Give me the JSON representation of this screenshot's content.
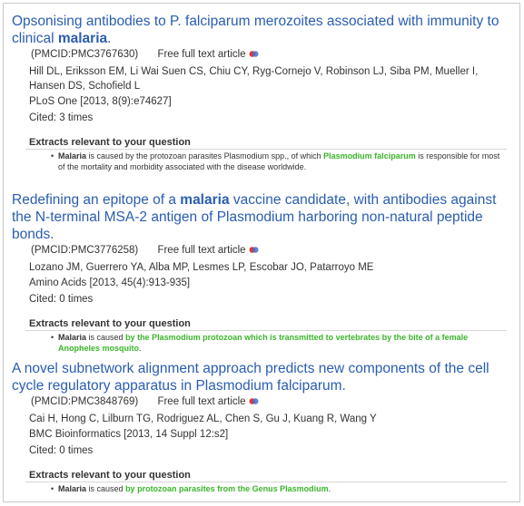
{
  "results": [
    {
      "title_pre": "Opsonising antibodies to P. falciparum merozoites associated with immunity to clinical ",
      "title_kw": "malaria",
      "title_post": ".",
      "pmcid": "(PMCID:PMC3767630)",
      "free_label": "Free full text article",
      "authors": "Hill DL, Eriksson EM, Li Wai Suen CS, Chiu CY, Ryg-Cornejo V, Robinson LJ, Siba PM, Mueller I, Hansen DS, Schofield L",
      "journal": "PLoS One [2013, 8(9):e74627]",
      "cited": "Cited: 3 times",
      "extracts_heading": "Extracts relevant to your question",
      "extract": {
        "kw": "Malaria",
        "pre": " is caused by the protozoan parasites Plasmodium spp., of which ",
        "hl": "Plasmodium falciparum",
        "post": " is responsible for most of the mortality and morbidity associated with the disease worldwide."
      }
    },
    {
      "title_pre": "Redefining an epitope of a ",
      "title_kw": "malaria",
      "title_post": " vaccine candidate, with antibodies against the N-terminal MSA-2 antigen of Plasmodium harboring non-natural peptide bonds.",
      "pmcid": "(PMCID:PMC3776258)",
      "free_label": "Free full text article",
      "authors": "Lozano JM, Guerrero YA, Alba MP, Lesmes LP, Escobar JO, Patarroyo ME",
      "journal": "Amino Acids [2013, 45(4):913-935]",
      "cited": "Cited: 0 times",
      "extracts_heading": "Extracts relevant to your question",
      "extract": {
        "kw": "Malaria",
        "pre": " is caused ",
        "hl": "by the Plasmodium protozoan which is transmitted to vertebrates by the bite of a female Anopheles mosquito",
        "post": "."
      }
    },
    {
      "title_pre": "A novel subnetwork alignment approach predicts new components of the cell cycle regulatory apparatus in Plasmodium falciparum.",
      "title_kw": "",
      "title_post": "",
      "pmcid": "(PMCID:PMC3848769)",
      "free_label": "Free full text article",
      "authors": "Cai H, Hong C, Lilburn TG, Rodriguez AL, Chen S, Gu J, Kuang R, Wang Y",
      "journal": "BMC Bioinformatics [2013, 14 Suppl 12:s2]",
      "cited": "Cited: 0 times",
      "extracts_heading": "Extracts relevant to your question",
      "extract": {
        "kw": "Malaria",
        "pre": " is caused ",
        "hl": "by protozoan parasites from the Genus Plasmodium",
        "post": "."
      }
    }
  ],
  "colors": {
    "title_link": "#2a5db0",
    "highlight": "#3bb52b",
    "icon_red": "#e8332f",
    "icon_blue": "#3f6fd1"
  },
  "icons": {
    "open_access": "open-access-icon"
  }
}
